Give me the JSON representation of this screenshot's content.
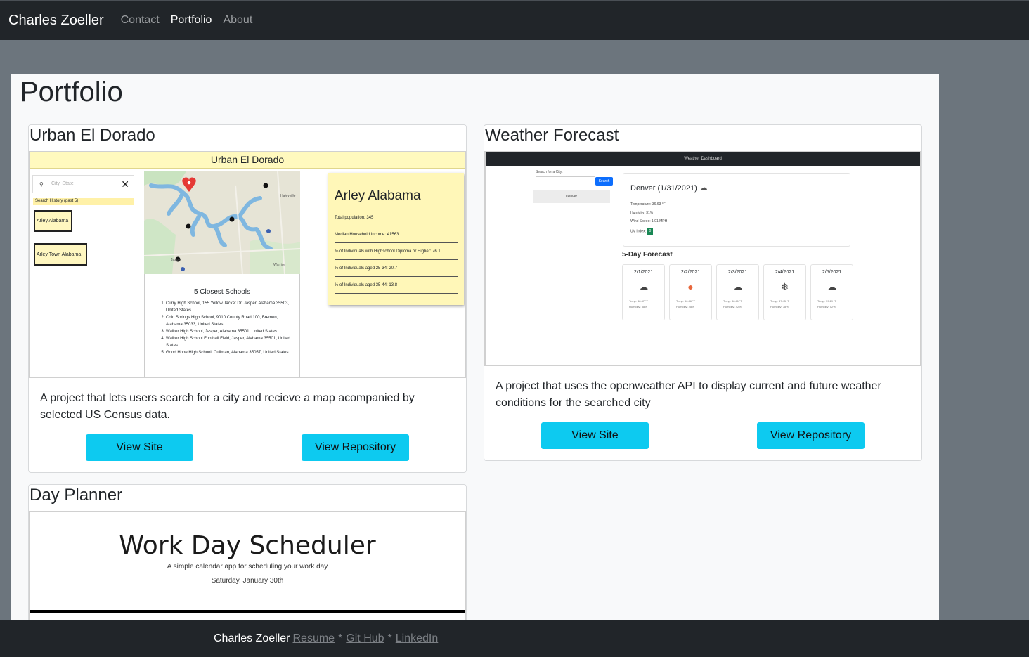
{
  "navbar": {
    "brand": "Charles Zoeller",
    "links": [
      "Contact",
      "Portfolio",
      "About"
    ]
  },
  "page": {
    "title": "Portfolio"
  },
  "projects": [
    {
      "title": "Urban El Dorado",
      "description": "A project that lets users search for a city and recieve a map acompanied by selected US Census data.",
      "view_site": "View Site",
      "view_repo": "View Repository",
      "screenshot": {
        "header": "Urban El Dorado",
        "search_placeholder": "City, State",
        "history_label": "Search History (past 5)",
        "history_items": [
          "Arley Alabama",
          "Arley Town Alabama"
        ],
        "map_labels": [
          "Haleyville",
          "Jasper",
          "Warrior"
        ],
        "schools_title": "5 Closest Schools",
        "schools": [
          "Curry High School, 155 Yellow Jacket Dr, Jasper, Alabama 35503, United States",
          "Cold Springs High School, 9010 County Road 100, Bremen, Alabama 35033, United States",
          "Walker High School, Jasper, Alabama 35501, United States",
          "Walker High School Football Field, Jasper, Alabama 35501, United States",
          "Good Hope High School, Cullman, Alabama 35057, United States"
        ],
        "note_title": "Arley Alabama",
        "note_lines": [
          "Total population: 345",
          "Median Household Income: 41563",
          "% of Individuals with Highschool Diploma or Higher: 76.1",
          "% of Individuals aged 25-34: 20.7",
          "% of Individuals aged 35-44: 13.8"
        ]
      }
    },
    {
      "title": "Weather Forecast",
      "description": "A project that uses the openweather API to display current and future weather conditions for the searched city",
      "view_site": "View Site",
      "view_repo": "View Repository",
      "screenshot": {
        "header": "Weather Dashboard",
        "search_label": "Search for a City:",
        "search_button": "Search",
        "history_city": "Denver",
        "current_title": "Denver (1/31/2021)",
        "temperature": "Temperature: 36.63 °F",
        "humidity": "Humidity: 31%",
        "wind": "Wind Speed: 1.01 MPH",
        "uv_label": "UV Index:",
        "uv_value": "0",
        "forecast_title": "5-Day Forecast",
        "days": [
          {
            "date": "2/1/2021",
            "icon": "cloud-icon",
            "glyph": "☁",
            "temp": "Temp: 48.47 °F",
            "humidity": "Humidity: 38%"
          },
          {
            "date": "2/2/2021",
            "icon": "sun-icon",
            "glyph": "●",
            "temp": "Temp: 56.86 °F",
            "humidity": "Humidity: 48%"
          },
          {
            "date": "2/3/2021",
            "icon": "cloud-icon",
            "glyph": "☁",
            "temp": "Temp: 38.81 °F",
            "humidity": "Humidity: 42%"
          },
          {
            "date": "2/4/2021",
            "icon": "snow-icon",
            "glyph": "❄",
            "temp": "Temp: 37.45 °F",
            "humidity": "Humidity: 78%"
          },
          {
            "date": "2/5/2021",
            "icon": "cloud-icon",
            "glyph": "☁",
            "temp": "Temp: 39.29 °F",
            "humidity": "Humidity: 52%"
          }
        ]
      }
    },
    {
      "title": "Day Planner",
      "screenshot": {
        "title": "Work Day Scheduler",
        "subtitle": "A simple calendar app for scheduling your work day",
        "date": "Saturday, January 30th"
      }
    }
  ],
  "footer": {
    "name": "Charles Zoeller",
    "links": [
      "Resume",
      "Git Hub",
      "LinkedIn"
    ],
    "separator": "*"
  },
  "colors": {
    "navbar_bg": "#212529",
    "page_bg": "#6c757d",
    "button_bg": "#0dcaf0",
    "note_bg": "#fff7b8"
  }
}
